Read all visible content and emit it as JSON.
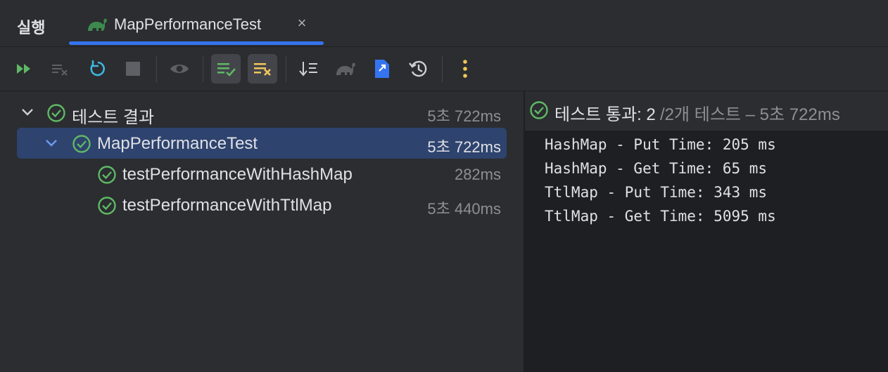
{
  "header": {
    "run_label": "실행",
    "tab": {
      "title": "MapPerformanceTest",
      "icon": "gradle-icon",
      "close_label": "×"
    }
  },
  "toolbar": {
    "buttons": [
      {
        "name": "rerun-failed-icon"
      },
      {
        "name": "clear-icon"
      },
      {
        "name": "rerun-icon"
      },
      {
        "name": "stop-icon"
      },
      {
        "name": "eye-icon"
      },
      {
        "name": "show-passed-icon",
        "active": true
      },
      {
        "name": "show-ignored-icon",
        "active": true
      },
      {
        "name": "sort-icon"
      },
      {
        "name": "gradle-icon"
      },
      {
        "name": "export-icon"
      },
      {
        "name": "history-icon"
      },
      {
        "name": "more-icon"
      }
    ]
  },
  "tree": {
    "root": {
      "label": "테스트 결과",
      "time": "5초 722ms"
    },
    "suite": {
      "label": "MapPerformanceTest",
      "time": "5초 722ms"
    },
    "tests": [
      {
        "label": "testPerformanceWithHashMap",
        "time": "282ms"
      },
      {
        "label": "testPerformanceWithTtlMap",
        "time": "5초 440ms"
      }
    ]
  },
  "result": {
    "passed": "테스트 통과: 2",
    "summary": "/2개 테스트 – 5초 722ms",
    "console": [
      "HashMap - Put Time: 205 ms",
      "HashMap - Get Time: 65 ms",
      "TtlMap - Put Time: 343 ms",
      "TtlMap - Get Time: 5095 ms"
    ]
  },
  "colors": {
    "accent": "#3574f0",
    "success": "#5fb865",
    "warning": "#f2c55c",
    "run_green": "#5fb865",
    "selected_row": "#2e436e"
  }
}
